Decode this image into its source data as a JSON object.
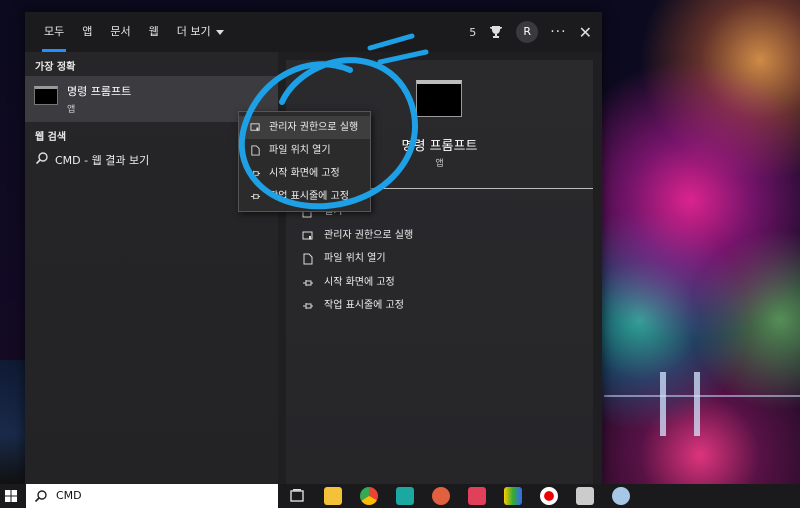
{
  "start_menu": {
    "tabs": [
      "모두",
      "앱",
      "문서",
      "웹",
      "더 보기"
    ],
    "active_tab": "모두",
    "points": "5",
    "user_initial": "R",
    "more_symbol": "···",
    "close_symbol": "✕"
  },
  "results": {
    "best_match_header": "가장 정확",
    "best_match": {
      "title": "명령 프롬프트",
      "subtitle": "앱"
    },
    "web_header": "웹 검색",
    "web_result": "CMD - 웹 결과 보기"
  },
  "context_menu": {
    "items": [
      "관리자 권한으로 실행",
      "파일 위치 열기",
      "시작 화면에 고정",
      "작업 표시줄에 고정"
    ]
  },
  "preview": {
    "title": "명령 프롬프트",
    "subtitle": "앱",
    "actions": [
      "열기",
      "관리자 권한으로 실행",
      "파일 위치 열기",
      "시작 화면에 고정",
      "작업 표시줄에 고정"
    ]
  },
  "taskbar": {
    "search_value": "CMD"
  },
  "colors": {
    "accent": "#1e90ff",
    "annotation": "#1ea0e6"
  }
}
